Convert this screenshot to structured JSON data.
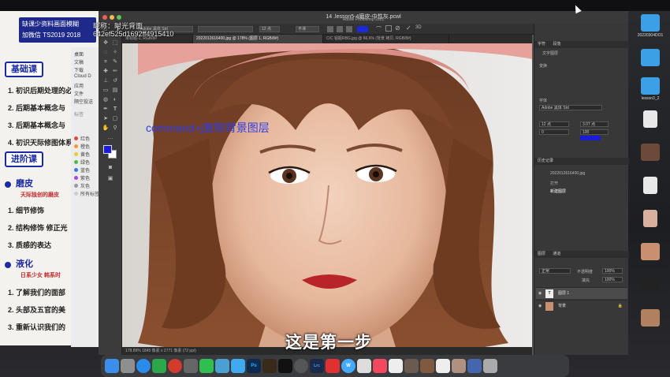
{
  "menubar": {
    "items": [
      "",
      "",
      "",
      ""
    ],
    "time": ""
  },
  "course_window": {
    "banner_line1": "缺课少资料画面模糊",
    "banner_line2": "加微信 TS2019 2018",
    "watermark_line1": "昵称：时光背面",
    "watermark_line2": "642ef525d1692ff4915410",
    "section1_title": "基础课",
    "section1_rows": [
      "1. 初识后期处理的必",
      "2. 后期基本概念与",
      "3. 后期基本概念与",
      "4. 初识天际修图体系"
    ],
    "section2_title": "进阶课",
    "topic1_title": "磨皮",
    "topic1_sub": "天际独创的磨皮",
    "topic1_rows": [
      "1. 细节修饰",
      "2. 结构修饰 修正光",
      "3. 质感的表达"
    ],
    "topic2_title": "液化",
    "topic2_sub": "日系少女  韩系时",
    "topic2_rows": [
      "1. 了解我们的面部",
      "2. 头部及五官的美",
      "3. 重新认识我们的"
    ]
  },
  "finder": {
    "items": [
      "桌面",
      "文稿",
      "下载",
      "Cloud D",
      "应用",
      "文件",
      "隔空投送"
    ],
    "tags_title": "标签",
    "tags": [
      "红色",
      "橙色",
      "黄色",
      "绿色",
      "蓝色",
      "紫色",
      "灰色",
      "所有标签"
    ],
    "tag_colors": [
      "#e04a3a",
      "#f09a30",
      "#e8cc30",
      "#4cbb4c",
      "#3a7ae0",
      "#a84ad8",
      "#999999",
      "#cccccc"
    ]
  },
  "photoshop": {
    "window_title": "14 .lesson5-4磨皮-中性灰.pcwl",
    "app_subtitle": "Adobe Photoshop 2021",
    "tabs": [
      {
        "label": "未标题-1, RGB/8#",
        "active": false
      },
      {
        "label": "2022012616400.jpg @ 178% (图层 1, RGB/8#)",
        "active": true
      },
      {
        "label": "C/C 铝瓶RBG.jpg @ 66.6% (背景 拷贝, RGB/8#)",
        "active": false
      }
    ],
    "options_controls": [
      "Adobe 黑体 Std",
      "",
      "12 点",
      "平滑"
    ],
    "annotation": "command+j复制背景图层",
    "subtitle": "这是第一步",
    "status_bar": "178.89%   1845 像素 x 2771 像素 (72 ppi)",
    "panel": {
      "char_title": "字符",
      "paragraph_title": "段落",
      "properties_title": "属性",
      "tab_title": "文字图层",
      "transform_title": "变换",
      "font_label": "字体",
      "font_value": "Adobe 黑体 Std",
      "size_value": "12 点",
      "leading_value": "3.07 点",
      "tracking_value": "0",
      "scale_value": "100",
      "color_label": "颜色",
      "history_title": "历史记录",
      "history_items": [
        "2022012616400.jpg",
        "打开",
        "新建图层"
      ],
      "layers_title": "图层",
      "channels_title": "通道",
      "blend_mode": "正常",
      "opacity_label": "不透明度",
      "opacity_value": "100%",
      "fill_label": "填充",
      "fill_value": "100%",
      "layers": [
        {
          "name": "图层 1",
          "selected": true
        },
        {
          "name": "背景",
          "selected": false
        }
      ]
    }
  },
  "desktop": {
    "icons": [
      {
        "label": "20220304DO1",
        "color": "#3ba0e6"
      },
      {
        "label": "",
        "color": "#3ba0e6"
      },
      {
        "label": "lesson3_2",
        "color": "#3ba0e6"
      },
      {
        "label": "",
        "color": "#e8e8e8"
      },
      {
        "label": "",
        "color": "#6b4a3a"
      },
      {
        "label": "",
        "color": "#e8e8e8"
      },
      {
        "label": "",
        "color": "#d8b0a0"
      },
      {
        "label": "",
        "color": "#c89070"
      },
      {
        "label": "",
        "color": "#222222"
      },
      {
        "label": "",
        "color": "#b08060"
      }
    ]
  },
  "dock": {
    "apps": [
      {
        "name": "finder",
        "color": "#3b8eea"
      },
      {
        "name": "launchpad",
        "color": "#8f8f8f"
      },
      {
        "name": "safari",
        "color": "#2a8bea"
      },
      {
        "name": "app-green",
        "color": "#2aa84a"
      },
      {
        "name": "netease-music",
        "color": "#d33b2f"
      },
      {
        "name": "app-grey",
        "color": "#666"
      },
      {
        "name": "wechat",
        "color": "#2fbf4f"
      },
      {
        "name": "app-sim",
        "color": "#4aa0d0"
      },
      {
        "name": "app-qq",
        "color": "#3faaf0"
      },
      {
        "name": "photoshop",
        "color": "#0e2a4f"
      },
      {
        "name": "bridge",
        "color": "#3a2a1a"
      },
      {
        "name": "capcut",
        "color": "#111"
      },
      {
        "name": "app-round",
        "color": "#555"
      },
      {
        "name": "lightroom",
        "color": "#1c2a4a"
      },
      {
        "name": "wps",
        "color": "#e03030"
      },
      {
        "name": "app-w",
        "color": "#44aaff"
      },
      {
        "name": "app-a",
        "color": "#dddddd"
      },
      {
        "name": "music",
        "color": "#f24860"
      },
      {
        "name": "doc",
        "color": "#eeeeee"
      },
      {
        "name": "img1",
        "color": "#6a5a50"
      },
      {
        "name": "img2",
        "color": "#805a40"
      },
      {
        "name": "doc2",
        "color": "#eeeeee"
      },
      {
        "name": "img3",
        "color": "#b09080"
      },
      {
        "name": "preview",
        "color": "#4466aa"
      },
      {
        "name": "trash",
        "color": "#aaaaaa"
      }
    ],
    "ps_label": "Ps",
    "lrc_label": "Lrc",
    "w_label": "W"
  }
}
